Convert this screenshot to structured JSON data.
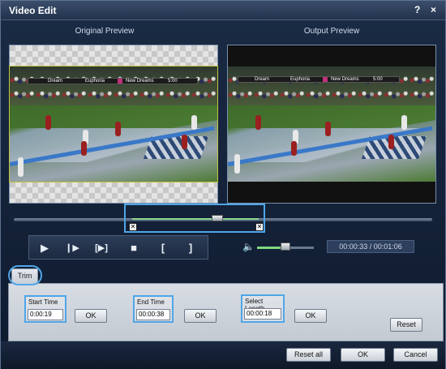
{
  "window": {
    "title": "Video Edit",
    "help": "?",
    "close": "×"
  },
  "preview": {
    "original_label": "Original Preview",
    "output_label": "Output Preview",
    "scoreboard": [
      "Dream",
      "Euphoria",
      "New Dreams",
      "5:00"
    ]
  },
  "controls": {
    "play": "▶",
    "step": "❙▶",
    "next_frame": "[▶]",
    "stop": "■",
    "mark_in": "[",
    "mark_out": "]",
    "volume_icon": "speaker-icon",
    "volume_level": 0.5,
    "timecode": "00:00:33 / 00:01:06"
  },
  "trim": {
    "tab_label": "Trim",
    "start_time_label": "Start Time",
    "start_time_value": "0:00:19",
    "end_time_label": "End Time",
    "end_time_value": "00:00:38",
    "select_length_label": "Select Length",
    "select_length_value": "00:00:18",
    "ok_label": "OK",
    "reset_label": "Reset"
  },
  "footer": {
    "reset_all": "Reset all",
    "ok": "OK",
    "cancel": "Cancel"
  },
  "colors": {
    "accent": "#4fa6e8",
    "window_bg": "#1a2b45"
  }
}
